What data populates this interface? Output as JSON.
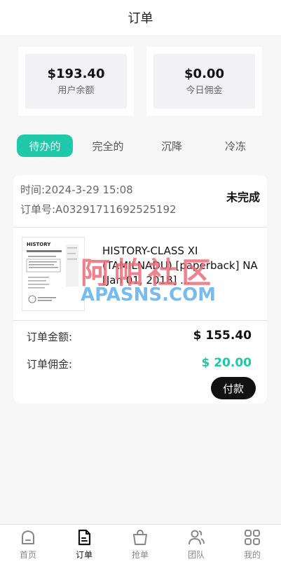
{
  "header": {
    "title": "订单"
  },
  "stats": [
    {
      "value": "$193.40",
      "label": "用户余额"
    },
    {
      "value": "$0.00",
      "label": "今日佣金"
    }
  ],
  "tabs": [
    {
      "label": "待办的",
      "active": true
    },
    {
      "label": "完全的",
      "active": false
    },
    {
      "label": "沉降",
      "active": false
    },
    {
      "label": "冷冻",
      "active": false
    }
  ],
  "order": {
    "time": "时间:2024-3-29 15:08",
    "order_no": "订单号:A03291711692525192",
    "status": "未完成",
    "product_title": "HISTORY-CLASS XI (TAMILNADU) [paperback] NA [Jan 01, 2018] ...",
    "thumb_text": "HISTORY",
    "amount_label": "订单金额:",
    "amount_value": "$ 155.40",
    "commission_label": "订单佣金:",
    "commission_value": "$ 20.00",
    "pay_button": "付款"
  },
  "watermark": {
    "cn": "阿帕社区",
    "en": "APASNS.COM"
  },
  "nav": [
    {
      "label": "首页",
      "icon": "home-icon",
      "active": false
    },
    {
      "label": "订单",
      "icon": "order-doc-icon",
      "active": true
    },
    {
      "label": "抢单",
      "icon": "shopping-bag-icon",
      "active": false
    },
    {
      "label": "团队",
      "icon": "team-icon",
      "active": false
    },
    {
      "label": "我的",
      "icon": "grid-icon",
      "active": false
    }
  ],
  "colors": {
    "accent": "#1fc8a8",
    "commission": "#1fc8a8",
    "dark": "#111111"
  }
}
